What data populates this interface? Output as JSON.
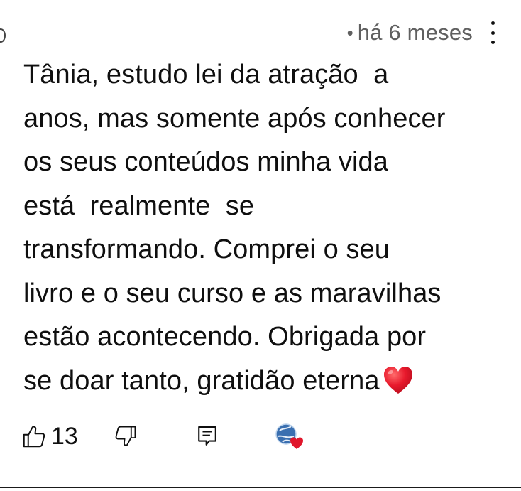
{
  "comment": {
    "meta_bullet": "•",
    "timestamp": "há 6 meses",
    "text": "Tânia, estudo lei da atração  a\nanos, mas somente após conhecer\nos seus conteúdos minha vida\nestá  realmente  se\ntransformando. Comprei o seu\nlivro e o seu curso e as maravilhas\nestão acontecendo. Obrigada por\nse doar tanto, gratidão eterna",
    "trailing_emoji": "red-heart"
  },
  "actions": {
    "like_count": "13",
    "like_icon": "thumbs-up-icon",
    "dislike_icon": "thumbs-down-icon",
    "reply_icon": "reply-icon",
    "creator_heart_icon": "creator-heart-icon"
  },
  "colors": {
    "text": "#0f0f0f",
    "secondary_text": "#606060",
    "heart": "#e0162b",
    "avatar": "#3a6fb0"
  }
}
